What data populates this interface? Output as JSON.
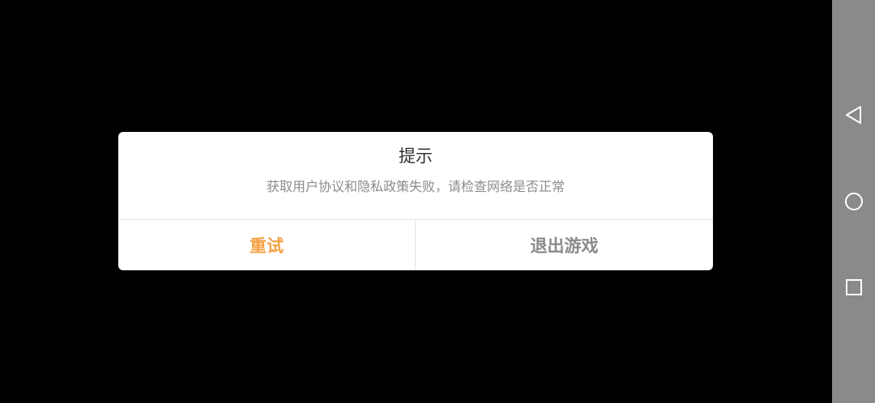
{
  "dialog": {
    "title": "提示",
    "message": "获取用户协议和隐私政策失败，请检查网络是否正常",
    "retry_label": "重试",
    "exit_label": "退出游戏"
  },
  "colors": {
    "background": "#000000",
    "dialog_background": "#ffffff",
    "retry_accent": "#f5a142",
    "exit_text": "#8a8a8a",
    "nav_bar": "#8a8a8a"
  },
  "nav_bar": {
    "icons": [
      "back-triangle-icon",
      "home-circle-icon",
      "recent-apps-square-icon"
    ]
  }
}
